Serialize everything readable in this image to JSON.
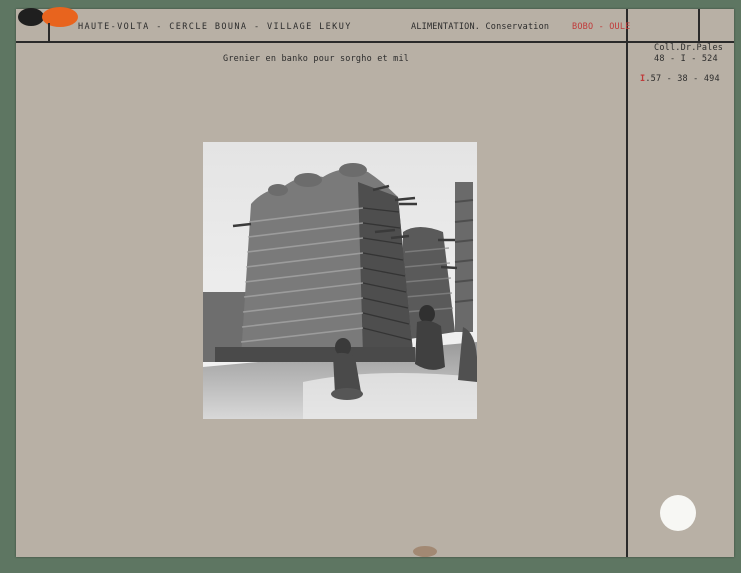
{
  "header": {
    "location": "HAUTE-VOLTA - CERCLE BOUNA - VILLAGE LEKUY",
    "subject": "ALIMENTATION. Conservation",
    "group": "BOBO - OULE"
  },
  "collection": {
    "line1": "Coll.Dr.Pales",
    "line2": "48 - I - 524",
    "inventory_prefix": "I",
    "inventory_rest": ".57 - 38 - 494"
  },
  "caption": "Grenier en banko pour sorgho et mil",
  "colors": {
    "background": "#5e7662",
    "card": "#b8b0a5",
    "accent_red": "#c03a3a",
    "tab_orange": "#e8641e",
    "tab_dark": "#1f1f1f"
  }
}
